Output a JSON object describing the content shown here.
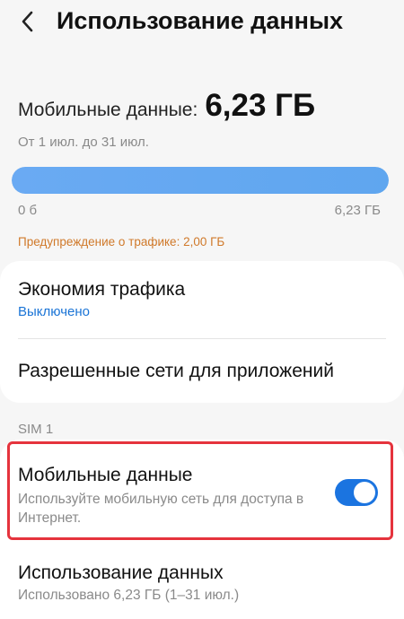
{
  "header": {
    "title": "Использование данных"
  },
  "summary": {
    "label": "Мобильные данные:",
    "value": "6,23 ГБ",
    "period": "От 1 июл. до 31 июл.",
    "bar_fraction": 1.0,
    "bar_min_label": "0 б",
    "bar_max_label": "6,23 ГБ",
    "warning": "Предупреждение о трафике: 2,00 ГБ"
  },
  "settings": {
    "traffic_saver": {
      "title": "Экономия трафика",
      "status": "Выключено"
    },
    "allowed_networks": {
      "title": "Разрешенные сети для приложений"
    }
  },
  "sim": {
    "section_label": "SIM 1",
    "mobile_data": {
      "title": "Мобильные данные",
      "description": "Используйте мобильную сеть для доступа в Интернет.",
      "enabled": true
    },
    "data_usage": {
      "title": "Использование данных",
      "subtitle": "Использовано 6,23 ГБ (1–31 июл.)"
    }
  },
  "colors": {
    "accent": "#1b74e0",
    "status_link": "#1a74d6",
    "warning": "#d0792a",
    "highlight_border": "#e5333d",
    "bar_fill": "#5fa6ef"
  },
  "icons": {
    "back": "chevron-left-icon"
  }
}
